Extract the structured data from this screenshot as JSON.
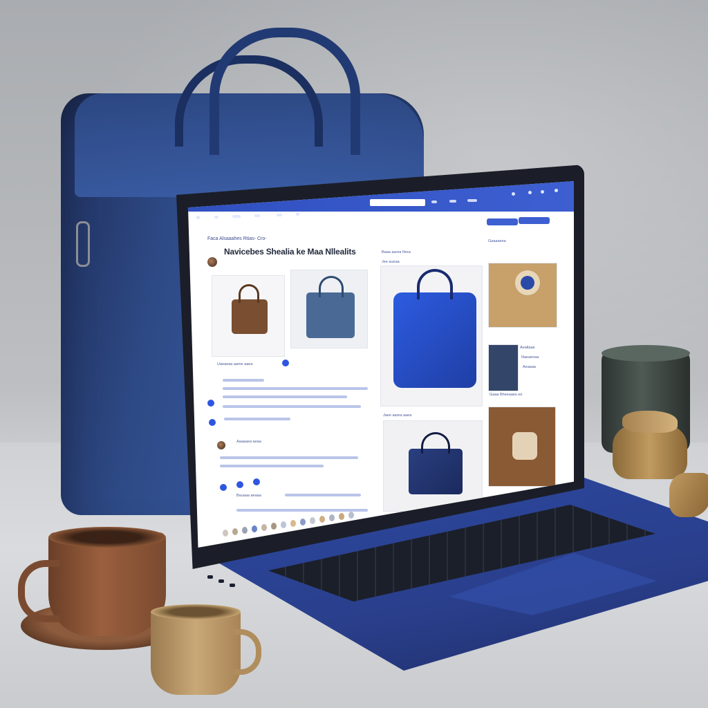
{
  "screen": {
    "breadcrumb": "Faca  Alsaaahes Rtias-  Cro-",
    "headline": "Navicebes Shealia ke Maa Nllealits",
    "right_header": "Baaa aarea  Nrea",
    "right_sub": "Jee aueaa",
    "caption_mid_left": "Uaeaeaa aame aaea",
    "caption_mid": "Jaee aarea aaea",
    "caption_mid_right": "Gaaa Bheeaaes ee",
    "small_label_1": "Aealtaae",
    "small_label_2": "Naeaenaa",
    "small_label_3": "Aeaaaa",
    "small_label_4": "Gaaaaeea",
    "comment_label": "Aaaaaea aeaa",
    "list_label": "Bauaaa aeaaa"
  },
  "colors": {
    "accent": "#3050c0",
    "bag_blue": "#2e4a86",
    "laptop_blue": "#2c48a0"
  }
}
